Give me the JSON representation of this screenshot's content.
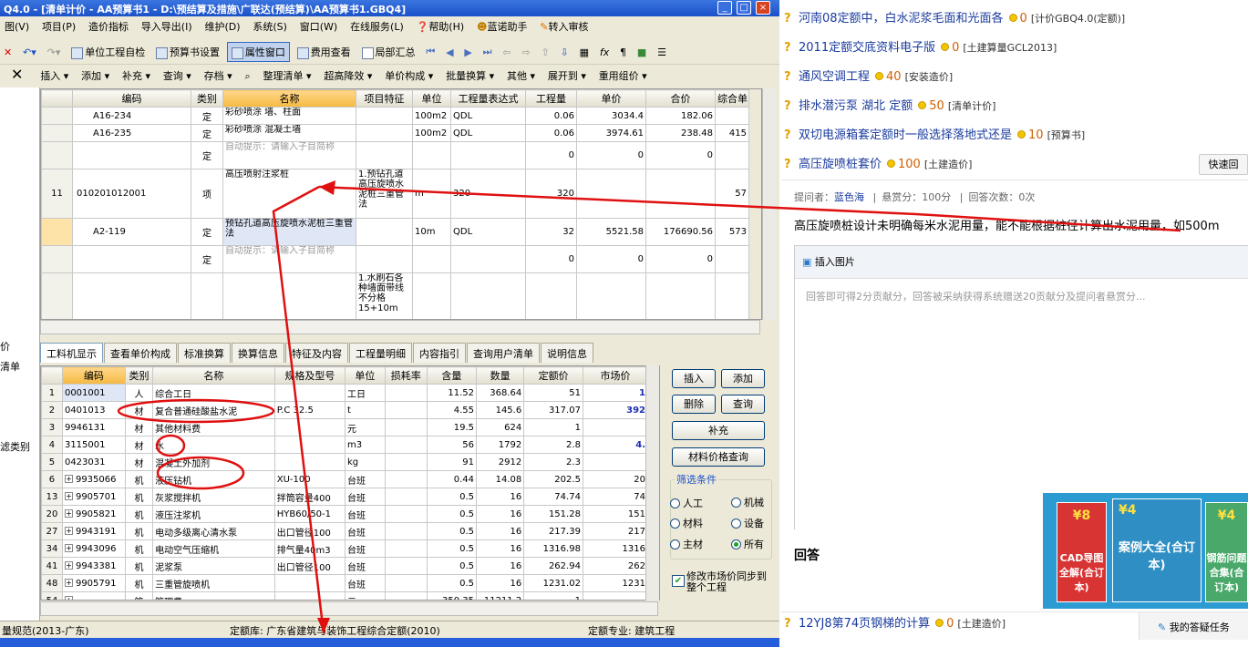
{
  "window": {
    "title": "Q4.0 - [清单计价 - AA预算书1 - D:\\预结算及措施\\广联达(预结算)\\AA预算书1.GBQ4]"
  },
  "menu": [
    "图(V)",
    "项目(P)",
    "造价指标",
    "导入导出(I)",
    "维护(D)",
    "系统(S)",
    "窗口(W)",
    "在线服务(L)",
    "帮助(H)",
    "蓝诺助手",
    "转入审核"
  ],
  "toolbar1": {
    "unit_check": "单位工程自检",
    "budget_settings": "预算书设置",
    "attr_window": "属性窗口",
    "fee_view": "费用查看",
    "partial_summary": "局部汇总"
  },
  "toolbar2": [
    "插入",
    "添加",
    "补充",
    "查询",
    "存档",
    "整理清单",
    "超高降效",
    "单价构成",
    "批量换算",
    "其他",
    "展开到",
    "重用组价"
  ],
  "top_grid": {
    "headers": [
      "编码",
      "类别",
      "名称",
      "项目特征",
      "单位",
      "工程量表达式",
      "工程量",
      "单价",
      "合价",
      "综合单"
    ],
    "rows": [
      {
        "no": "",
        "code": "A16-234",
        "type": "定",
        "name": "彩砂喷涂 墙、柱面",
        "feature": "",
        "unit": "100m2",
        "expr": "QDL",
        "qty": "0.06",
        "price": "3034.4",
        "total": "182.06",
        "comp": ""
      },
      {
        "no": "",
        "code": "A16-235",
        "type": "定",
        "name": "彩砂喷涂 混凝土墙",
        "feature": "",
        "unit": "100m2",
        "expr": "QDL",
        "qty": "0.06",
        "price": "3974.61",
        "total": "238.48",
        "comp": "415"
      },
      {
        "no": "",
        "code": "",
        "type": "定",
        "name": "自动提示：请输入子目简称",
        "feature": "",
        "unit": "",
        "expr": "",
        "qty": "0",
        "price": "0",
        "total": "0",
        "comp": ""
      },
      {
        "no": "11",
        "code": "010201012001",
        "type": "项",
        "name": "高压喷射注浆桩",
        "feature": "1.预钻孔道高压旋喷水泥桩三重管法",
        "unit": "m",
        "expr": "320",
        "qty": "320",
        "price": "",
        "total": "",
        "comp": "57"
      },
      {
        "no": "",
        "code": "A2-119",
        "type": "定",
        "name": "预钻孔道高压旋喷水泥桩三重管法",
        "feature": "",
        "unit": "10m",
        "expr": "QDL",
        "qty": "32",
        "price": "5521.58",
        "total": "176690.56",
        "comp": "573"
      },
      {
        "no": "",
        "code": "",
        "type": "定",
        "name": "自动提示：请输入子目简称",
        "feature": "",
        "unit": "",
        "expr": "",
        "qty": "0",
        "price": "0",
        "total": "0",
        "comp": ""
      },
      {
        "no": "",
        "code": "",
        "type": "",
        "name": "",
        "feature": "1.水刷石各种墙面带线不分格 15+10m",
        "unit": "",
        "expr": "",
        "qty": "",
        "price": "",
        "total": "",
        "comp": ""
      }
    ]
  },
  "tabs": [
    "工料机显示",
    "查看单价构成",
    "标准换算",
    "换算信息",
    "特征及内容",
    "工程量明细",
    "内容指引",
    "查询用户清单",
    "说明信息"
  ],
  "bottom_grid": {
    "headers": [
      "编码",
      "类别",
      "名称",
      "规格及型号",
      "单位",
      "损耗率",
      "含量",
      "数量",
      "定额价",
      "市场价"
    ],
    "rows": [
      {
        "no": "1",
        "code": "0001001",
        "type": "人",
        "name": "综合工日",
        "spec": "",
        "unit": "工日",
        "loss": "",
        "amt": "11.52",
        "qty": "368.64",
        "base": "51",
        "market": "1"
      },
      {
        "no": "2",
        "code": "0401013",
        "type": "材",
        "name": "复合普通硅酸盐水泥",
        "spec": "P.C 32.5",
        "unit": "t",
        "loss": "",
        "amt": "4.55",
        "qty": "145.6",
        "base": "317.07",
        "market": "392"
      },
      {
        "no": "3",
        "code": "9946131",
        "type": "材",
        "name": "其他材料费",
        "spec": "",
        "unit": "元",
        "loss": "",
        "amt": "19.5",
        "qty": "624",
        "base": "1",
        "market": ""
      },
      {
        "no": "4",
        "code": "3115001",
        "type": "材",
        "name": "水",
        "spec": "",
        "unit": "m3",
        "loss": "",
        "amt": "56",
        "qty": "1792",
        "base": "2.8",
        "market": "4."
      },
      {
        "no": "5",
        "code": "0423031",
        "type": "材",
        "name": "混凝土外加剂",
        "spec": "",
        "unit": "kg",
        "loss": "",
        "amt": "91",
        "qty": "2912",
        "base": "2.3",
        "market": ""
      },
      {
        "no": "6",
        "code": "9935066",
        "type": "机",
        "name": "液压钻机",
        "spec": "XU-100",
        "unit": "台班",
        "loss": "",
        "amt": "0.44",
        "qty": "14.08",
        "base": "202.5",
        "market": "20"
      },
      {
        "no": "13",
        "code": "9905701",
        "type": "机",
        "name": "灰浆搅拌机",
        "spec": "拌筒容量400",
        "unit": "台班",
        "loss": "",
        "amt": "0.5",
        "qty": "16",
        "base": "74.74",
        "market": "74"
      },
      {
        "no": "20",
        "code": "9905821",
        "type": "机",
        "name": "液压注浆机",
        "spec": "HYB60/50-1",
        "unit": "台班",
        "loss": "",
        "amt": "0.5",
        "qty": "16",
        "base": "151.28",
        "market": "151"
      },
      {
        "no": "27",
        "code": "9943191",
        "type": "机",
        "name": "电动多级离心清水泵",
        "spec": "出口管径100",
        "unit": "台班",
        "loss": "",
        "amt": "0.5",
        "qty": "16",
        "base": "217.39",
        "market": "217"
      },
      {
        "no": "34",
        "code": "9943096",
        "type": "机",
        "name": "电动空气压缩机",
        "spec": "排气量40m3",
        "unit": "台班",
        "loss": "",
        "amt": "0.5",
        "qty": "16",
        "base": "1316.98",
        "market": "1316"
      },
      {
        "no": "41",
        "code": "9943381",
        "type": "机",
        "name": "泥浆泵",
        "spec": "出口管径100",
        "unit": "台班",
        "loss": "",
        "amt": "0.5",
        "qty": "16",
        "base": "262.94",
        "market": "262"
      },
      {
        "no": "48",
        "code": "9905791",
        "type": "机",
        "name": "三重管旋喷机",
        "spec": "",
        "unit": "台班",
        "loss": "",
        "amt": "0.5",
        "qty": "16",
        "base": "1231.02",
        "market": "1231"
      },
      {
        "no": "54",
        "code": "",
        "type": "管",
        "name": "管理费",
        "spec": "",
        "unit": "元",
        "loss": "",
        "amt": "350.35",
        "qty": "11211.2",
        "base": "1",
        "market": ""
      }
    ]
  },
  "side_buttons": {
    "insert": "插入",
    "add": "添加",
    "delete": "删除",
    "query": "查询",
    "supplement": "补充",
    "price_query": "材料价格查询"
  },
  "filter": {
    "title": "筛选条件",
    "options": [
      "人工",
      "机械",
      "材料",
      "设备",
      "主材",
      "所有"
    ],
    "selected": "所有",
    "sync_label": "修改市场价同步到整个工程"
  },
  "left_strip": [
    "价",
    "清单",
    "滤类别"
  ],
  "statusbar": {
    "norm": "量规范(2013-广东)",
    "quota_lib": "定额库: 广东省建筑与装饰工程综合定额(2010)",
    "quota_major": "定额专业: 建筑工程"
  },
  "right": {
    "questions": [
      {
        "title": "河南08定额中，白水泥浆毛面和光面各",
        "reward": "0",
        "tag": "[计价GBQ4.0(定额)]"
      },
      {
        "title": "2011定额交底资料电子版",
        "reward": "0",
        "tag": "[土建算量GCL2013]"
      },
      {
        "title": "通风空调工程",
        "reward": "40",
        "tag": "[安装造价]"
      },
      {
        "title": "排水潜污泵 湖北 定额",
        "reward": "50",
        "tag": "[清单计价]"
      },
      {
        "title": "双切电源箱套定额时一般选择落地式还是",
        "reward": "10",
        "tag": "[预算书]"
      },
      {
        "title": "高压旋喷桩套价",
        "reward": "100",
        "tag": "[土建造价]"
      }
    ],
    "quick_back": "快速回",
    "meta": {
      "asker_label": "提问者：",
      "asker": "蓝色海",
      "reward": "悬赏分：100分",
      "answers": "回答次数：0次"
    },
    "question_text": "高压旋喷桩设计未明确每米水泥用量，能不能根据桩径计算出水泥用量，如500m",
    "insert_image": "插入图片",
    "answer_placeholder": "回答即可得2分贡献分，回答被采纳获得系统赠送20贡献分及提问者悬赏分...",
    "answer_heading": "回答",
    "ad": {
      "book1": "CAD导图全解(合订本)",
      "book2": "案例大全(合订本)",
      "book3": "钢筋问题合集(合订本)",
      "price1": "¥8",
      "price2": "¥4",
      "price3": "¥4"
    },
    "bottom_question": {
      "title": "12YJ8第74页钢梯的计算",
      "reward": "0",
      "tag": "[土建造价]"
    },
    "my_tasks": "我的答疑任务"
  },
  "colors": {
    "annotation": "#e01010",
    "titlebar": "#1c51c8",
    "selected_row": "#fde3a7"
  }
}
